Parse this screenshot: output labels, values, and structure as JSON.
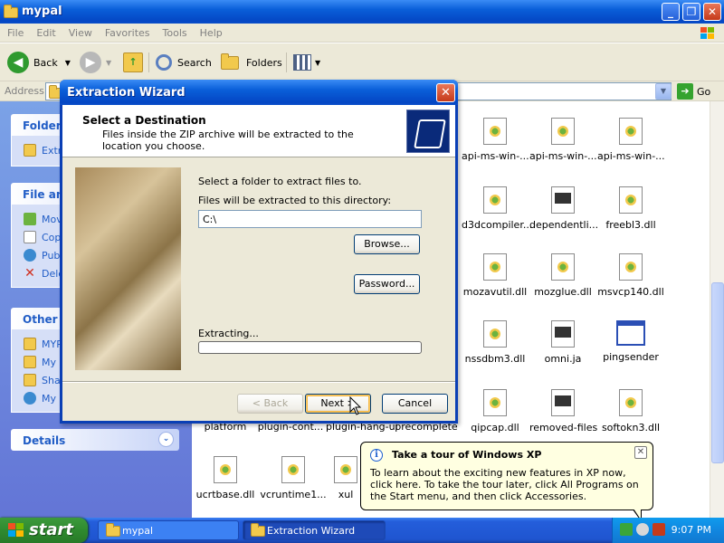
{
  "window": {
    "title": "mypal",
    "menu": [
      "File",
      "Edit",
      "View",
      "Favorites",
      "Tools",
      "Help"
    ]
  },
  "toolbar": {
    "back_label": "Back",
    "search_label": "Search",
    "folders_label": "Folders"
  },
  "addressbar": {
    "label": "Address",
    "go_label": "Go"
  },
  "taskpane": {
    "folder_tasks": {
      "title": "Folder T",
      "items": [
        "Extr"
      ]
    },
    "file_tasks": {
      "title": "File and",
      "items": [
        "Mov",
        "Cop",
        "Pub",
        "Dele"
      ]
    },
    "other_places": {
      "title": "Other P",
      "items": [
        "MYP",
        "My",
        "Sha",
        "My"
      ]
    },
    "details": {
      "title": "Details"
    }
  },
  "files": [
    "api-ms-win-...",
    "api-ms-win-...",
    "api-ms-win-...",
    "d3dcompiler...",
    "dependentli...",
    "freebl3.dll",
    "mozavutil.dll",
    "mozglue.dll",
    "msvcp140.dll",
    "nssdbm3.dll",
    "omni.ja",
    "pingsender",
    "qipcap.dll",
    "removed-files",
    "softokn3.dll",
    "platform",
    "plugin-cont...",
    "plugin-hang-ui",
    "precomplete",
    "ucrtbase.dll",
    "vcruntime1...",
    "xul"
  ],
  "dialog": {
    "title": "Extraction Wizard",
    "close_glyph": "✕",
    "header_title": "Select a Destination",
    "header_desc": "Files inside the ZIP archive will be extracted to the location you choose.",
    "prompt": "Select a folder to extract files to.",
    "dir_label": "Files will be extracted to this directory:",
    "dir_value": "C:\\",
    "browse_label": "Browse...",
    "password_label": "Password...",
    "extracting_label": "Extracting...",
    "progress_fraction": 0.0,
    "back_label": "< Back",
    "next_label": "Next >",
    "cancel_label": "Cancel"
  },
  "balloon": {
    "title": "Take a tour of Windows XP",
    "close_glyph": "✕",
    "text": "To learn about the exciting new features in XP now, click here. To take the tour later, click All Programs on the Start menu, and then click Accessories."
  },
  "taskbar": {
    "start_label": "start",
    "tasks": [
      "mypal",
      "Extraction Wizard"
    ],
    "clock": "9:07 PM"
  }
}
